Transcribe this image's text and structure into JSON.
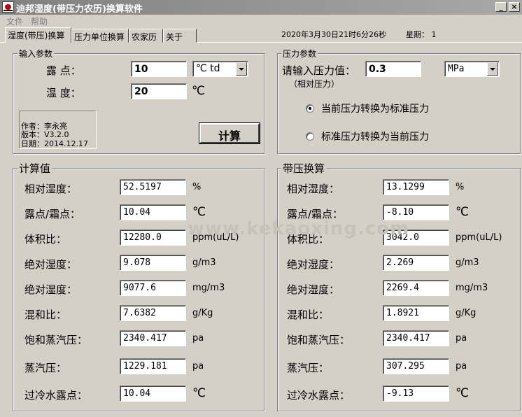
{
  "window": {
    "title": "迪邦湿度(带压力农历)换算软件",
    "minimize": "_",
    "close": "×"
  },
  "menu": {
    "items": [
      "文件",
      "帮助"
    ]
  },
  "tabs": [
    "湿度(带压)换算",
    "压力单位换算",
    "农家历",
    "关于"
  ],
  "status": {
    "datetime": "2020年3月30日21时6分26秒",
    "weekday": "星期： 1"
  },
  "input_params": {
    "legend": "输入参数",
    "dewpoint_label": "露  点：",
    "dewpoint_value": "10",
    "dewpoint_unit": "℃ td",
    "temperature_label": "温  度：",
    "temperature_value": "20",
    "temperature_unit": "℃",
    "info": {
      "author": "作者：李永亮",
      "version": "版本：V3.2.0",
      "date": "日期：2014.12.17"
    },
    "calculate_button": "计算"
  },
  "pressure_params": {
    "legend": "压力参数",
    "prompt": "请输入压力值：",
    "value": "0.3",
    "note": "（相对压力）",
    "unit": "MPa",
    "options": [
      "当前压力转换为标准压力",
      "标准压力转换为当前压力"
    ],
    "selected": 0
  },
  "results": {
    "legend": "计算值",
    "rows": [
      {
        "label": "相对湿度：",
        "value": "52.5197",
        "unit": "%"
      },
      {
        "label": "露点/霜点：",
        "value": "10.04",
        "unit": "℃"
      },
      {
        "label": "体积比：",
        "value": "12280.0",
        "unit": "ppm(uL/L)"
      },
      {
        "label": "绝对湿度：",
        "value": "9.078",
        "unit": "g/m3"
      },
      {
        "label": "绝对湿度：",
        "value": "9077.6",
        "unit": "mg/m3"
      },
      {
        "label": "混和比：",
        "value": "7.6382",
        "unit": "g/Kg"
      },
      {
        "label": "饱和蒸汽压：",
        "value": "2340.417",
        "unit": "pa"
      },
      {
        "label": "蒸汽压：",
        "value": "1229.181",
        "unit": "pa"
      },
      {
        "label": "过冷水露点：",
        "value": "10.04",
        "unit": "℃"
      }
    ]
  },
  "pressure_results": {
    "legend": "带压换算",
    "rows": [
      {
        "label": "相对湿度：",
        "value": "13.1299",
        "unit": "%"
      },
      {
        "label": "露点/霜点：",
        "value": "-8.10",
        "unit": "℃"
      },
      {
        "label": "体积比：",
        "value": "3042.0",
        "unit": "ppm(uL/L)"
      },
      {
        "label": "绝对湿度：",
        "value": "2.269",
        "unit": "g/m3"
      },
      {
        "label": "绝对湿度：",
        "value": "2269.4",
        "unit": "mg/m3"
      },
      {
        "label": "混和比：",
        "value": "1.8921",
        "unit": "g/Kg"
      },
      {
        "label": "饱和蒸汽压：",
        "value": "2340.417",
        "unit": "pa"
      },
      {
        "label": "蒸汽压：",
        "value": "307.295",
        "unit": "pa"
      },
      {
        "label": "过冷水露点：",
        "value": "-9.13",
        "unit": "℃"
      }
    ]
  },
  "watermark": "www.kekaoxing.com"
}
